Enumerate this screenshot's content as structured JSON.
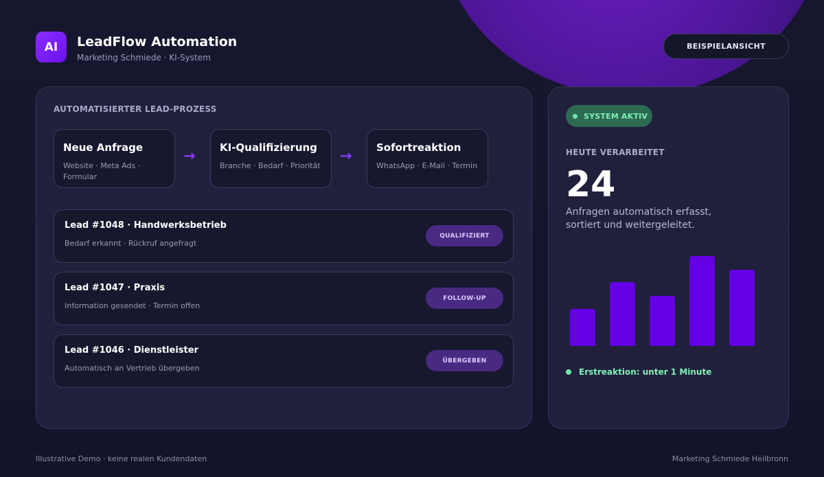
{
  "header": {
    "logo_text": "AI",
    "title": "LeadFlow Automation",
    "subtitle": "Marketing Schmiede · KI-System",
    "example_button": "BEISPIELANSICHT"
  },
  "process": {
    "heading": "AUTOMATISIERTER LEAD-PROZESS",
    "arrow": "→",
    "steps": [
      {
        "title": "Neue Anfrage",
        "desc": "Website · Meta Ads · Formular"
      },
      {
        "title": "KI-Qualifizierung",
        "desc": "Branche · Bedarf · Priorität"
      },
      {
        "title": "Sofortreaktion",
        "desc": "WhatsApp · E-Mail · Termin"
      }
    ]
  },
  "leads": [
    {
      "title": "Lead #1048 · Handwerksbetrieb",
      "desc": "Bedarf erkannt · Rückruf angefragt",
      "status": "QUALIFIZIERT"
    },
    {
      "title": "Lead #1047 · Praxis",
      "desc": "Information gesendet · Termin offen",
      "status": "FOLLOW-UP"
    },
    {
      "title": "Lead #1046 · Dienstleister",
      "desc": "Automatisch an Vertrieb übergeben",
      "status": "ÜBERGEBEN"
    }
  ],
  "stats": {
    "status": "SYSTEM AKTIV",
    "today_label": "HEUTE VERARBEITET",
    "today_value": "24",
    "description": "Anfragen automatisch erfasst, sortiert und weitergeleitet.",
    "first_response": "Erstreaktion: unter 1 Minute"
  },
  "chart_data": {
    "type": "bar",
    "values": [
      0.41,
      0.71,
      0.56,
      1.0,
      0.85
    ],
    "note_on_scale": "relative bar heights, no axis printed",
    "color": "#6300e6"
  },
  "footer": {
    "left": "Illustrative Demo · keine realen Kundendaten",
    "right": "Marketing Schmiede Heilbronn"
  },
  "colors": {
    "accent": "#6a12f0",
    "status_green": "#7ff0b5",
    "badge_bg": "#482a82"
  }
}
